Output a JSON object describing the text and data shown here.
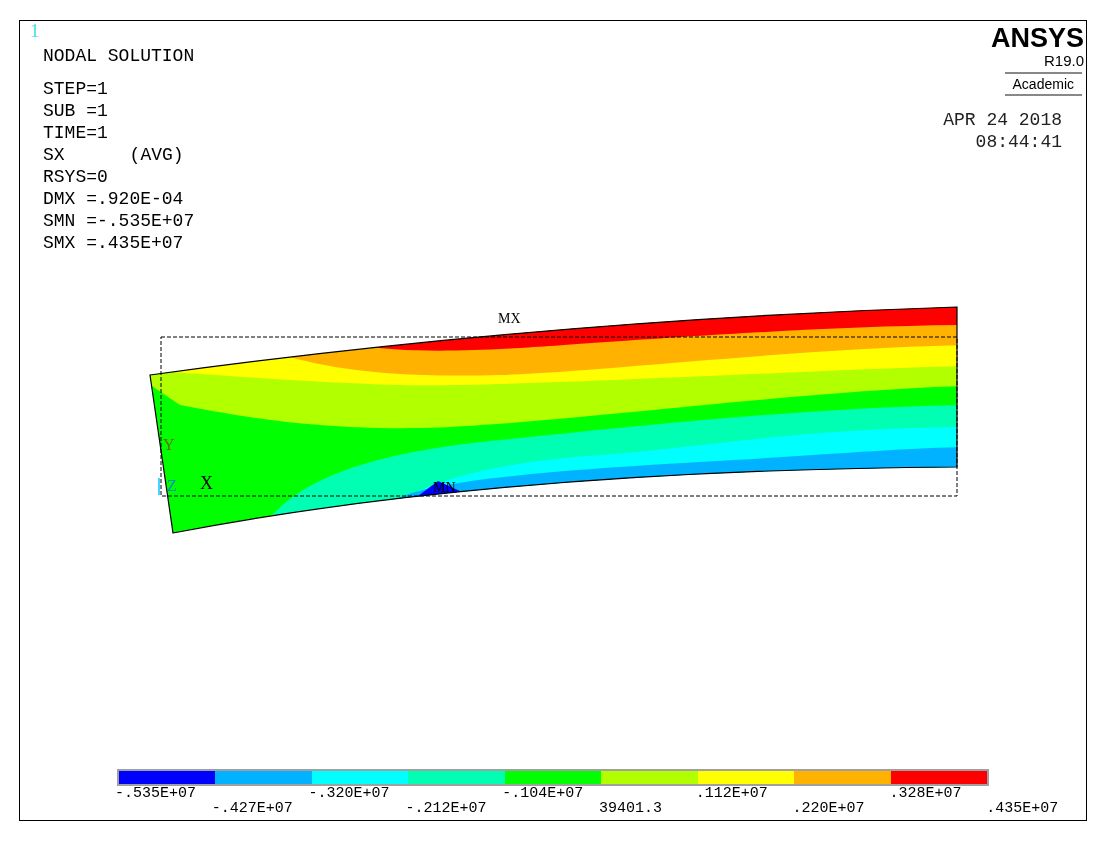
{
  "window_number": "1",
  "title": "NODAL SOLUTION",
  "info_lines": [
    {
      "label": "STEP=1"
    },
    {
      "label": "SUB =1"
    },
    {
      "label": "TIME=1"
    },
    {
      "label": "SX",
      "suffix": "(AVG)"
    },
    {
      "label": "RSYS=0"
    },
    {
      "label": "DMX =.920E-04"
    },
    {
      "label": "SMN =-.535E+07"
    },
    {
      "label": "SMX =.435E+07"
    }
  ],
  "logo": {
    "name": "ANSYS",
    "version": "R19.0",
    "edition": "Academic"
  },
  "date": "APR 24 2018",
  "time": "08:44:41",
  "plot": {
    "max_label": "MX",
    "min_label": "MN",
    "axes": {
      "x": "X",
      "y": "Y",
      "z": "Z"
    }
  },
  "legend": {
    "bands": [
      {
        "color": "#0000ff"
      },
      {
        "color": "#00b2ff"
      },
      {
        "color": "#00ffff"
      },
      {
        "color": "#00ffb2"
      },
      {
        "color": "#00ff00"
      },
      {
        "color": "#b2ff00"
      },
      {
        "color": "#ffff00"
      },
      {
        "color": "#ffb200"
      },
      {
        "color": "#ff0000"
      }
    ],
    "labels": [
      "-.535E+07",
      "-.427E+07",
      "-.320E+07",
      "-.212E+07",
      "-.104E+07",
      "39401.3",
      ".112E+07",
      ".220E+07",
      ".328E+07",
      ".435E+07"
    ]
  }
}
